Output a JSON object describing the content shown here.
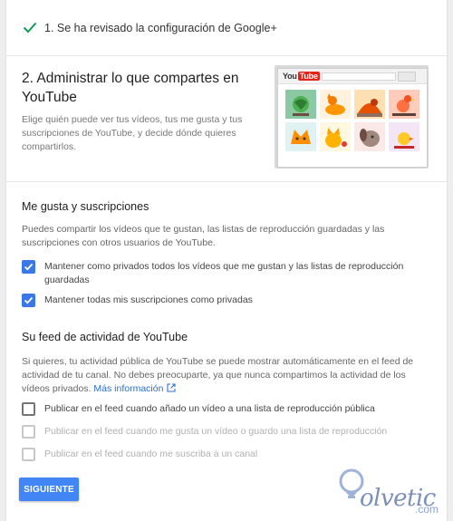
{
  "step_done": {
    "label": "1. Se ha revisado la configuración de Google+"
  },
  "manage": {
    "title": "2. Administrar lo que compartes en YouTube",
    "description": "Elige quién puede ver tus vídeos, tus me gusta y tus suscripciones de YouTube, y decide dónde quieres compartirlos.",
    "illustration_logo_text": "You",
    "illustration_logo_badge": "Tube"
  },
  "likes": {
    "heading": "Me gusta y suscripciones",
    "description": "Puedes compartir los vídeos que te gustan, las listas de reproducción guardadas y las suscripciones con otros usuarios de YouTube.",
    "options": [
      {
        "label": "Mantener como privados todos los vídeos que me gustan y las listas de reproducción guardadas",
        "checked": true
      },
      {
        "label": "Mantener todas mis suscripciones como privadas",
        "checked": true
      }
    ]
  },
  "feed": {
    "heading": "Su feed de actividad de YouTube",
    "description": "Si quieres, tu actividad pública de YouTube se puede mostrar automáticamente en el feed de actividad de tu canal. No debes preocuparte, ya que nunca compartimos la actividad de los vídeos privados.",
    "more_link": "Más información",
    "options": [
      {
        "label": "Publicar en el feed cuando añado un vídeo a una lista de reproducción pública",
        "checked": false,
        "disabled": false
      },
      {
        "label": "Publicar en el feed cuando me gusta un vídeo o guardo una lista de reproducción",
        "checked": false,
        "disabled": true
      },
      {
        "label": "Publicar en el feed cuando me suscriba a un canal",
        "checked": false,
        "disabled": true
      }
    ]
  },
  "actions": {
    "next_label": "SIGUIENTE"
  },
  "watermark": {
    "text": "olvetic",
    "suffix": ".com"
  },
  "colors": {
    "accent": "#4285f4",
    "checkbox_on": "#3b78e7",
    "check_green": "#0f9d58",
    "link": "#2a6fd1"
  }
}
